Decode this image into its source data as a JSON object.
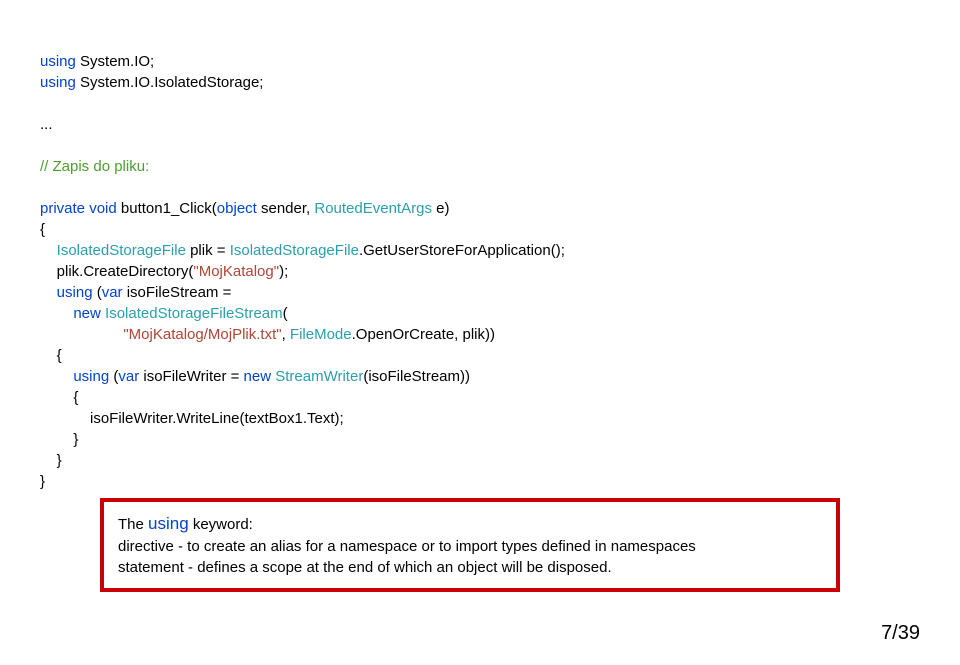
{
  "code": {
    "l1a": "using",
    "l1b": " System.IO;",
    "l2a": "using",
    "l2b": " System.IO.IsolatedStorage;",
    "l3": "...",
    "l4": "// Zapis do pliku:",
    "l5a": "private",
    "l5b": " ",
    "l5c": "void",
    "l5d": " button1_Click(",
    "l5e": "object",
    "l5f": " sender, ",
    "l5g": "RoutedEventArgs",
    "l5h": " e)",
    "l6": "{",
    "l7a": "    ",
    "l7b": "IsolatedStorageFile",
    "l7c": " plik = ",
    "l7d": "IsolatedStorageFile",
    "l7e": ".GetUserStoreForApplication();",
    "l8a": "    plik.CreateDirectory(",
    "l8b": "\"MojKatalog\"",
    "l8c": ");",
    "l9a": "    ",
    "l9b": "using",
    "l9c": " (",
    "l9d": "var",
    "l9e": " isoFileStream =",
    "l10a": "        ",
    "l10b": "new",
    "l10c": " ",
    "l10d": "IsolatedStorageFileStream",
    "l10e": "(",
    "l11a": "                    ",
    "l11b": "\"MojKatalog/MojPlik.txt\"",
    "l11c": ", ",
    "l11d": "FileMode",
    "l11e": ".OpenOrCreate, plik))",
    "l12": "    {",
    "l13a": "        ",
    "l13b": "using",
    "l13c": " (",
    "l13d": "var",
    "l13e": " isoFileWriter = ",
    "l13f": "new",
    "l13g": " ",
    "l13h": "StreamWriter",
    "l13i": "(isoFileStream))",
    "l14": "        {",
    "l15": "            isoFileWriter.WriteLine(textBox1.Text);",
    "l16": "        }",
    "l17": "    }",
    "l18": "}"
  },
  "note": {
    "line1a": "The ",
    "line1b": "using",
    "line1c": " keyword:",
    "line2": "directive - to create an alias for a namespace or to import types defined in  namespaces",
    "line3": "statement - defines a scope at the end of which an object will be disposed."
  },
  "pagenum": "7/39"
}
